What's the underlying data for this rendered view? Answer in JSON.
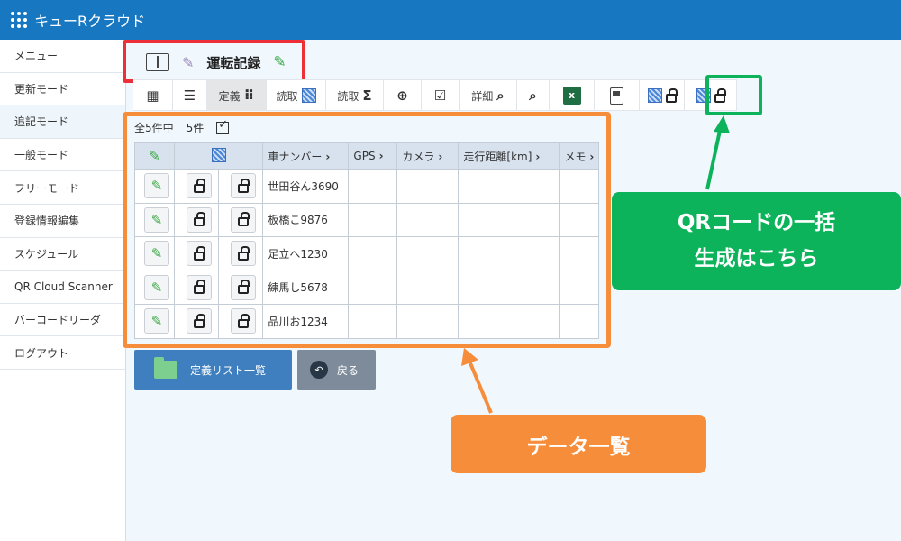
{
  "app": {
    "title": "キューRクラウド"
  },
  "sidebar": {
    "items": [
      {
        "label": "メニュー"
      },
      {
        "label": "更新モード"
      },
      {
        "label": "追記モード"
      },
      {
        "label": "一般モード"
      },
      {
        "label": "フリーモード"
      },
      {
        "label": "登録情報編集"
      },
      {
        "label": "スケジュール"
      },
      {
        "label": "QR Cloud Scanner"
      },
      {
        "label": "バーコードリーダ"
      },
      {
        "label": "ログアウト"
      }
    ]
  },
  "page": {
    "title": "運転記録"
  },
  "toolbar": {
    "definition_label": "定義",
    "read_label": "読取",
    "read_sum_label": "読取",
    "detail_label": "詳細",
    "excel_icon_text": "x"
  },
  "table": {
    "total_text": "全5件中",
    "count_text": "5件",
    "columns": [
      "車ナンバー",
      "GPS",
      "カメラ",
      "走行距離[km]",
      "メモ"
    ],
    "rows": [
      {
        "car": "世田谷ん3690"
      },
      {
        "car": "板橋こ9876"
      },
      {
        "car": "足立へ1230"
      },
      {
        "car": "練馬し5678"
      },
      {
        "car": "品川お1234"
      }
    ]
  },
  "buttons": {
    "definition_list": "定義リスト一覧",
    "back": "戻る"
  },
  "callouts": {
    "qr_line1": "QRコードの一括",
    "qr_line2": "生成はこちら",
    "data_list": "データ一覧"
  },
  "colors": {
    "header": "#1777c0",
    "highlight_red": "#ee2f38",
    "highlight_orange": "#f68d3a",
    "highlight_green": "#0cb35a"
  }
}
